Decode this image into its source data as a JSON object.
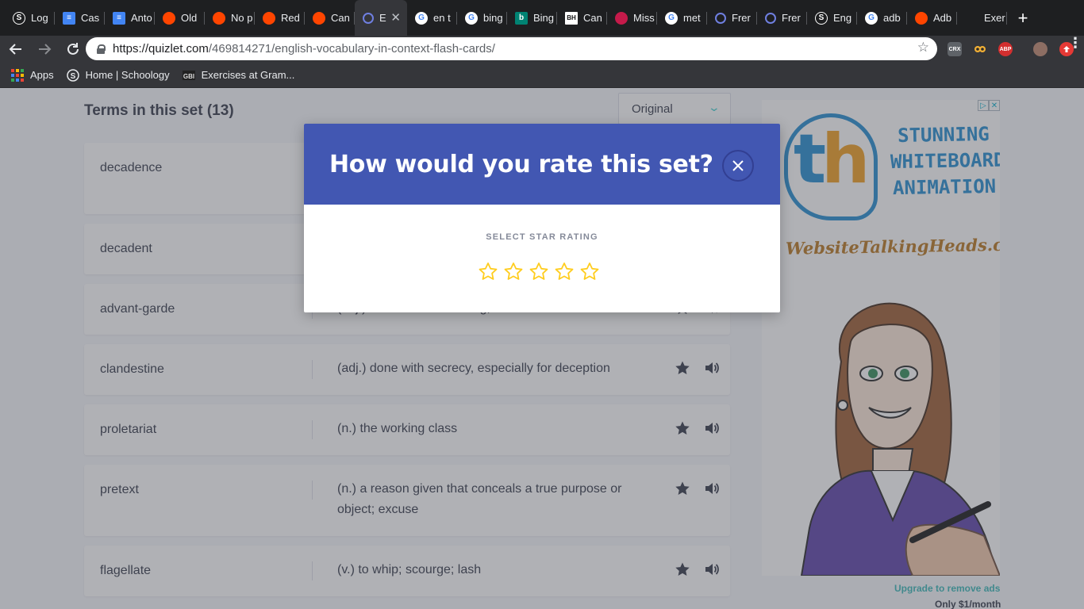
{
  "browser": {
    "tabs": [
      {
        "label": "Log",
        "icon": "schoology-icon",
        "color": "#1fa6d8"
      },
      {
        "label": "Cas",
        "icon": "google-docs-icon",
        "color": "#4285f4"
      },
      {
        "label": "Anto",
        "icon": "google-docs-icon",
        "color": "#4285f4"
      },
      {
        "label": "Old",
        "icon": "reddit-alien-icon",
        "color": "#ff4500"
      },
      {
        "label": "No p",
        "icon": "reddit-icon",
        "color": "#ff4500"
      },
      {
        "label": "Red",
        "icon": "reddit-icon",
        "color": "#ff4500"
      },
      {
        "label": "Can",
        "icon": "reddit-icon",
        "color": "#ff4500"
      },
      {
        "label": "E",
        "icon": "quizlet-icon",
        "color": "#4257b2",
        "active": true
      },
      {
        "label": "en t",
        "icon": "google-icon",
        "color": "#ffffff"
      },
      {
        "label": "bing",
        "icon": "google-icon",
        "color": "#ffffff"
      },
      {
        "label": "Bing",
        "icon": "bing-icon",
        "color": "#008373"
      },
      {
        "label": "Can",
        "icon": "bh-icon",
        "color": "#ffffff"
      },
      {
        "label": "Miss",
        "icon": "raspberry-icon",
        "color": "#c51a4a"
      },
      {
        "label": "met",
        "icon": "google-icon",
        "color": "#ffffff"
      },
      {
        "label": "Frer",
        "icon": "quizlet-icon",
        "color": "#4257b2"
      },
      {
        "label": "Frer",
        "icon": "quizlet-icon",
        "color": "#4257b2"
      },
      {
        "label": "Eng",
        "icon": "schoology-icon",
        "color": "#1fa6d8"
      },
      {
        "label": "adb",
        "icon": "google-icon",
        "color": "#ffffff"
      },
      {
        "label": "Adb",
        "icon": "reddit-alien-icon",
        "color": "#ff4500"
      },
      {
        "label": "Exer",
        "icon": "",
        "color": ""
      }
    ],
    "url_host": "https://quizlet.com",
    "url_path": "/469814271/english-vocabulary-in-context-flash-cards/",
    "extensions": [
      "CRX",
      "ABP"
    ],
    "bookmarks": {
      "apps": "Apps",
      "schoology": "Home | Schoology",
      "gram": "Exercises at Gram..."
    }
  },
  "page": {
    "terms_heading": "Terms in this set (13)",
    "sort_value": "Original",
    "terms": [
      {
        "word": "decadence",
        "definition": ""
      },
      {
        "word": "decadent",
        "definition": ""
      },
      {
        "word": "advant-garde",
        "definition": "(adj.) unorthodox or daring; radical"
      },
      {
        "word": "clandestine",
        "definition": "(adj.) done with secrecy, especially for deception"
      },
      {
        "word": "proletariat",
        "definition": "(n.) the working class"
      },
      {
        "word": "pretext",
        "definition": "(n.) a reason given that conceals a true purpose or object; excuse"
      },
      {
        "word": "flagellate",
        "definition": "(v.) to whip; scourge; lash"
      }
    ]
  },
  "ad": {
    "logo": "th",
    "tagline": "STUNNING WHITEBOARD ANIMATION",
    "site": "WebsiteTalkingHeads.com",
    "upgrade": "Upgrade to remove ads",
    "price": "Only $1/month"
  },
  "modal": {
    "title": "How would you rate this set?",
    "rating_label": "SELECT STAR RATING",
    "star_count": 5,
    "selected_rating": 0,
    "star_color": "#ffcd1f"
  }
}
